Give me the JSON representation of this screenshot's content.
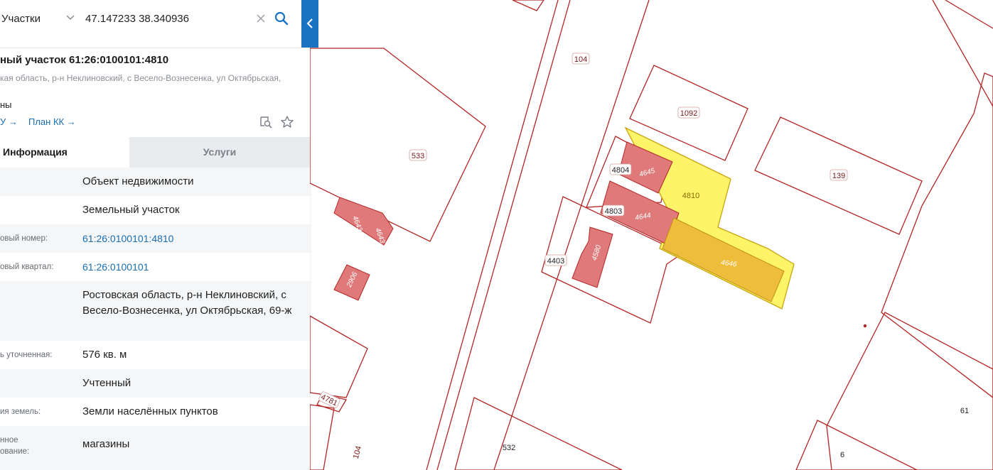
{
  "search": {
    "category": "Участки",
    "query": "47.147233 38.340936"
  },
  "object": {
    "title": "ный участок 61:26:0100101:4810",
    "address_subtitle": "кая область, р-н Неклиновский, с Весело-Вознесенка, ул Октябрьская,",
    "address_tail": "ны",
    "link_1": "У →",
    "link_2": "План КК →"
  },
  "tabs": {
    "info": "Информация",
    "services": "Услуги"
  },
  "info_rows": [
    {
      "label": "",
      "value": "Объект недвижимости"
    },
    {
      "label": "",
      "value": "Земельный участок"
    },
    {
      "label": "овый номер:",
      "value": "61:26:0100101:4810"
    },
    {
      "label": "овый квартал:",
      "value": "61:26:0100101"
    },
    {
      "label": "",
      "value": "Ростовская область, р-н Неклиновский, с Весело-Вознесенка, ул Октябрьская, 69-ж"
    },
    {
      "label": "ь уточненная:",
      "value": "576 кв. м"
    },
    {
      "label": "",
      "value": "Учтенный"
    },
    {
      "label": "ия земель:",
      "value": "Земли населённых пунктов"
    },
    {
      "label": "нное",
      "label2": "ование:",
      "value": "магазины"
    }
  ],
  "map": {
    "parcel_labels": [
      "104",
      "533",
      "1092",
      "139",
      "4810",
      "4804",
      "4803",
      "4403",
      "4781",
      "104",
      "532",
      "61",
      "6"
    ],
    "building_labels": [
      "4645",
      "4644",
      "4646",
      "4580",
      "4643",
      "4643",
      "2906"
    ]
  },
  "colors": {
    "accent": "#1a73c2",
    "link": "#1a6eb2",
    "parcel_line": "#b32525",
    "building": "#e07a7a",
    "selected_parcel": "#fdf46a",
    "selected_building": "#efbd3c"
  }
}
